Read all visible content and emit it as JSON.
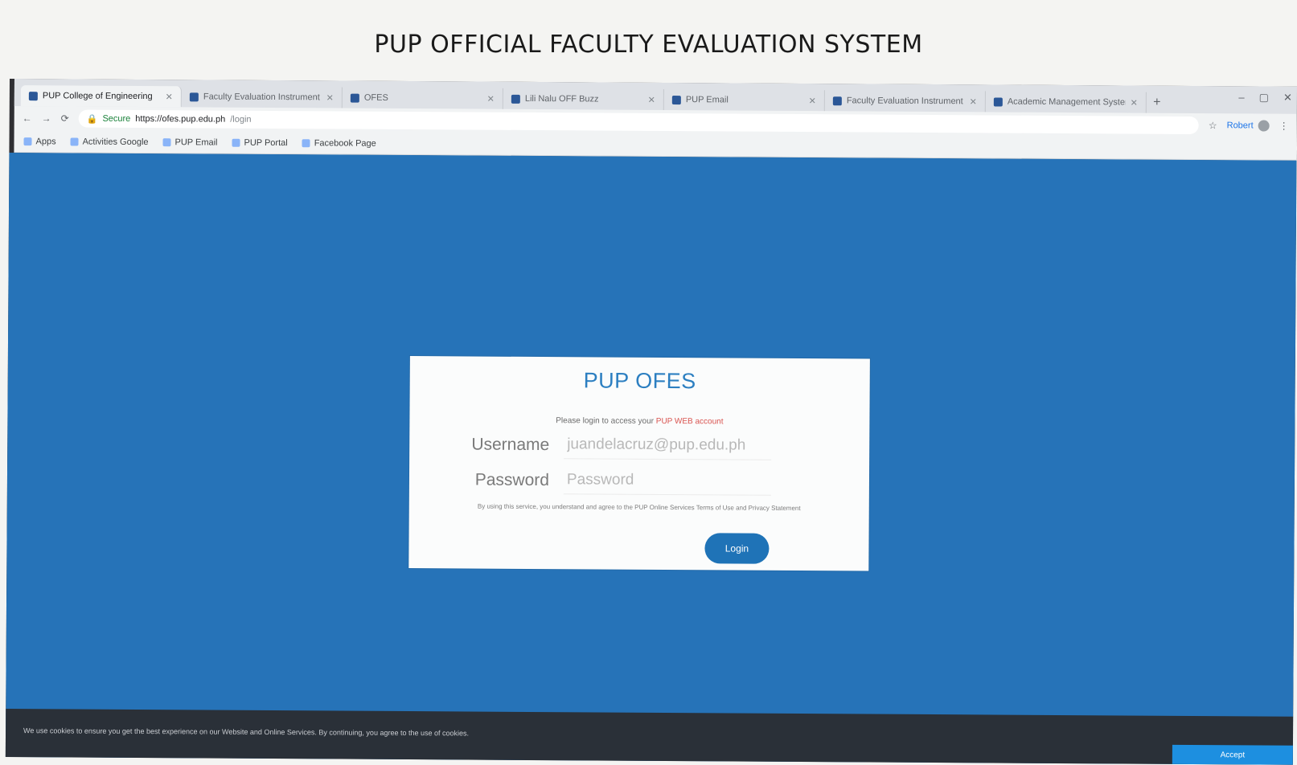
{
  "page": {
    "heading": "PUP OFFICIAL FACULTY EVALUATION SYSTEM"
  },
  "browser": {
    "tabs": [
      {
        "title": "PUP College of Engineering",
        "active": true
      },
      {
        "title": "Faculty Evaluation Instrument",
        "active": false
      },
      {
        "title": "OFES",
        "active": false
      },
      {
        "title": "Lili Nalu OFF Buzz",
        "active": false
      },
      {
        "title": "PUP Email",
        "active": false
      },
      {
        "title": "Faculty Evaluation Instrument",
        "active": false
      },
      {
        "title": "Academic Management System",
        "active": false
      }
    ],
    "address": {
      "secure_label": "Secure",
      "url": "https://ofes.pup.edu.ph",
      "path": "/login"
    },
    "profile_label": "Robert",
    "bookmarks": [
      {
        "label": "Apps"
      },
      {
        "label": "Activities Google"
      },
      {
        "label": "PUP Email"
      },
      {
        "label": "PUP Portal"
      },
      {
        "label": "Facebook Page"
      }
    ]
  },
  "login": {
    "title": "PUP OFES",
    "hint_text": "Please login to access your ",
    "hint_link": "PUP WEB account",
    "username_label": "Username",
    "username_placeholder": "juandelacruz@pup.edu.ph",
    "password_label": "Password",
    "password_placeholder": "Password",
    "terms_text": "By using this service, you understand and agree to the PUP Online Services Terms of Use and Privacy Statement",
    "button_label": "Login"
  },
  "cookie": {
    "text": "We use cookies to ensure you get the best experience on our Website and Online Services. By continuing, you agree to the use of cookies.",
    "button_label": "Accept"
  },
  "colors": {
    "viewport_bg": "#2673b8",
    "accent": "#2c7fc1",
    "link": "#d9534f"
  }
}
